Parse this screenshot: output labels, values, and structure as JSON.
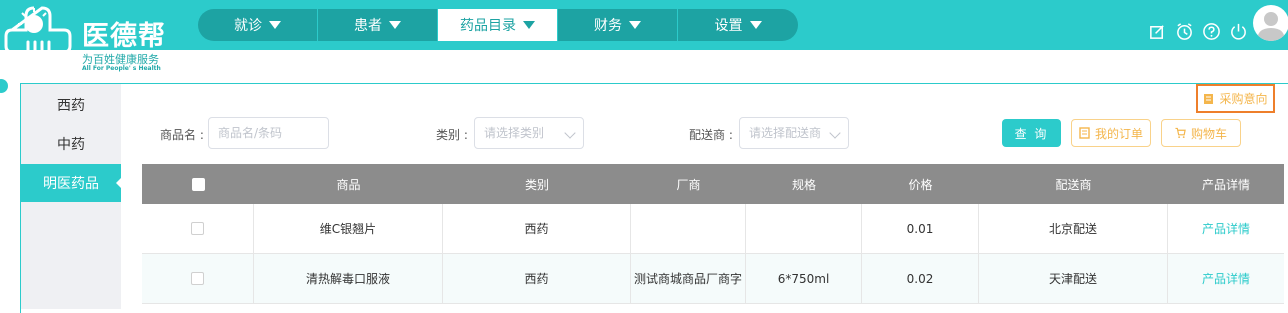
{
  "brand": {
    "title": "医德帮",
    "slogan": "为百姓健康服务",
    "tagline": "All For People' s Health"
  },
  "nav": {
    "items": [
      {
        "label": "就诊"
      },
      {
        "label": "患者"
      },
      {
        "label": "药品目录",
        "active": true
      },
      {
        "label": "财务"
      },
      {
        "label": "设置"
      }
    ]
  },
  "header_icons": [
    "edit-icon",
    "alarm-clock-icon",
    "help-icon",
    "power-icon"
  ],
  "sidebar": {
    "items": [
      {
        "label": "西药"
      },
      {
        "label": "中药"
      },
      {
        "label": "明医药品",
        "active": true
      }
    ]
  },
  "filters": {
    "product_label": "商品名 :",
    "product_placeholder": "商品名/条码",
    "category_label": "类别 :",
    "category_placeholder": "请选择类别",
    "supplier_label": "配送商 :",
    "supplier_placeholder": "请选择配送商"
  },
  "actions": {
    "query": "查 询",
    "my_orders": "我的订单",
    "cart": "购物车",
    "purchase_intent": "采购意向"
  },
  "table": {
    "headers": [
      "",
      "商品",
      "类别",
      "厂商",
      "规格",
      "价格",
      "配送商",
      "产品详情"
    ],
    "rows": [
      {
        "product": "维C银翘片",
        "category": "西药",
        "manufacturer": "",
        "spec": "",
        "price": "0.01",
        "supplier": "北京配送",
        "detail": "产品详情"
      },
      {
        "product": "清热解毒口服液",
        "category": "西药",
        "manufacturer": "测试商城商品厂商字",
        "spec": "6*750ml",
        "price": "0.02",
        "supplier": "天津配送",
        "detail": "产品详情"
      }
    ]
  },
  "colors": {
    "primary": "#2ccbcb",
    "nav_bg": "#1da3a3",
    "accent_orange": "#f4b64c",
    "highlight_border": "#ee7f2b",
    "table_header": "#8c8c8c"
  }
}
